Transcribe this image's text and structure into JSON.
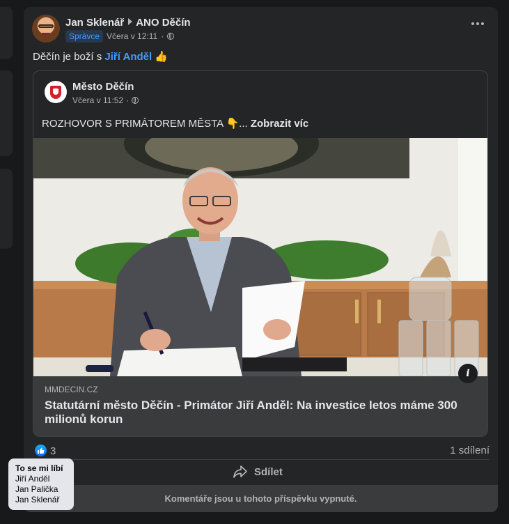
{
  "post": {
    "author": "Jan Sklenář",
    "group": "ANO Děčín",
    "role_badge": "Správce",
    "time": "Včera v 12:11",
    "text_prefix": "Děčín je boží s ",
    "mention": "Jiří Anděl",
    "emoji": "👍",
    "icons": {
      "menu": "more-horizontal-icon",
      "privacy": "globe-icon"
    }
  },
  "shared": {
    "page_name": "Město Děčín",
    "time": "Včera v 11:52",
    "text": "ROZHOVOR S PRIMÁTOREM MĚSTA 👇...",
    "see_more": "Zobrazit víc",
    "link": {
      "domain": "MMDECIN.CZ",
      "title": "Statutární město Děčín - Primátor Jiří Anděl: Na investice letos máme 300 milionů korun"
    },
    "info_label": "i"
  },
  "reactions": {
    "like_count": "3",
    "share_count": "1 sdílení"
  },
  "actions": {
    "share_label": "Sdílet"
  },
  "comments_disabled": "Komentáře jsou u tohoto příspěvku vypnuté.",
  "tooltip": {
    "title": "To se mi líbí",
    "names": [
      "Jiří Anděl",
      "Jan Palička",
      "Jan Sklenář"
    ]
  },
  "colors": {
    "accent": "#4599ff",
    "background": "#18191a",
    "card": "#242526"
  }
}
